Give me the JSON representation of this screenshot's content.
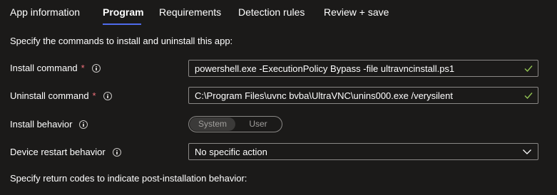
{
  "tabs": [
    {
      "label": "App information"
    },
    {
      "label": "Program"
    },
    {
      "label": "Requirements"
    },
    {
      "label": "Detection rules"
    },
    {
      "label": "Review + save"
    }
  ],
  "active_tab": "Program",
  "heading": "Specify the commands to install and uninstall this app:",
  "install": {
    "label": "Install command",
    "required_marker": "*",
    "value": "powershell.exe -ExecutionPolicy Bypass -file ultravncinstall.ps1"
  },
  "uninstall": {
    "label": "Uninstall command",
    "required_marker": "*",
    "value": "C:\\Program Files\\uvnc bvba\\UltraVNC\\unins000.exe /verysilent"
  },
  "install_behavior": {
    "label": "Install behavior",
    "options": [
      "System",
      "User"
    ],
    "selected": "System"
  },
  "restart": {
    "label": "Device restart behavior",
    "value": "No specific action"
  },
  "footer": "Specify return codes to indicate post-installation behavior:",
  "colors": {
    "background": "#1b1a19",
    "accent": "#4f6bed",
    "valid_check": "#92c353",
    "required": "#f1707b"
  },
  "icons": [
    "info-icon",
    "checkmark-icon",
    "chevron-down-icon"
  ]
}
